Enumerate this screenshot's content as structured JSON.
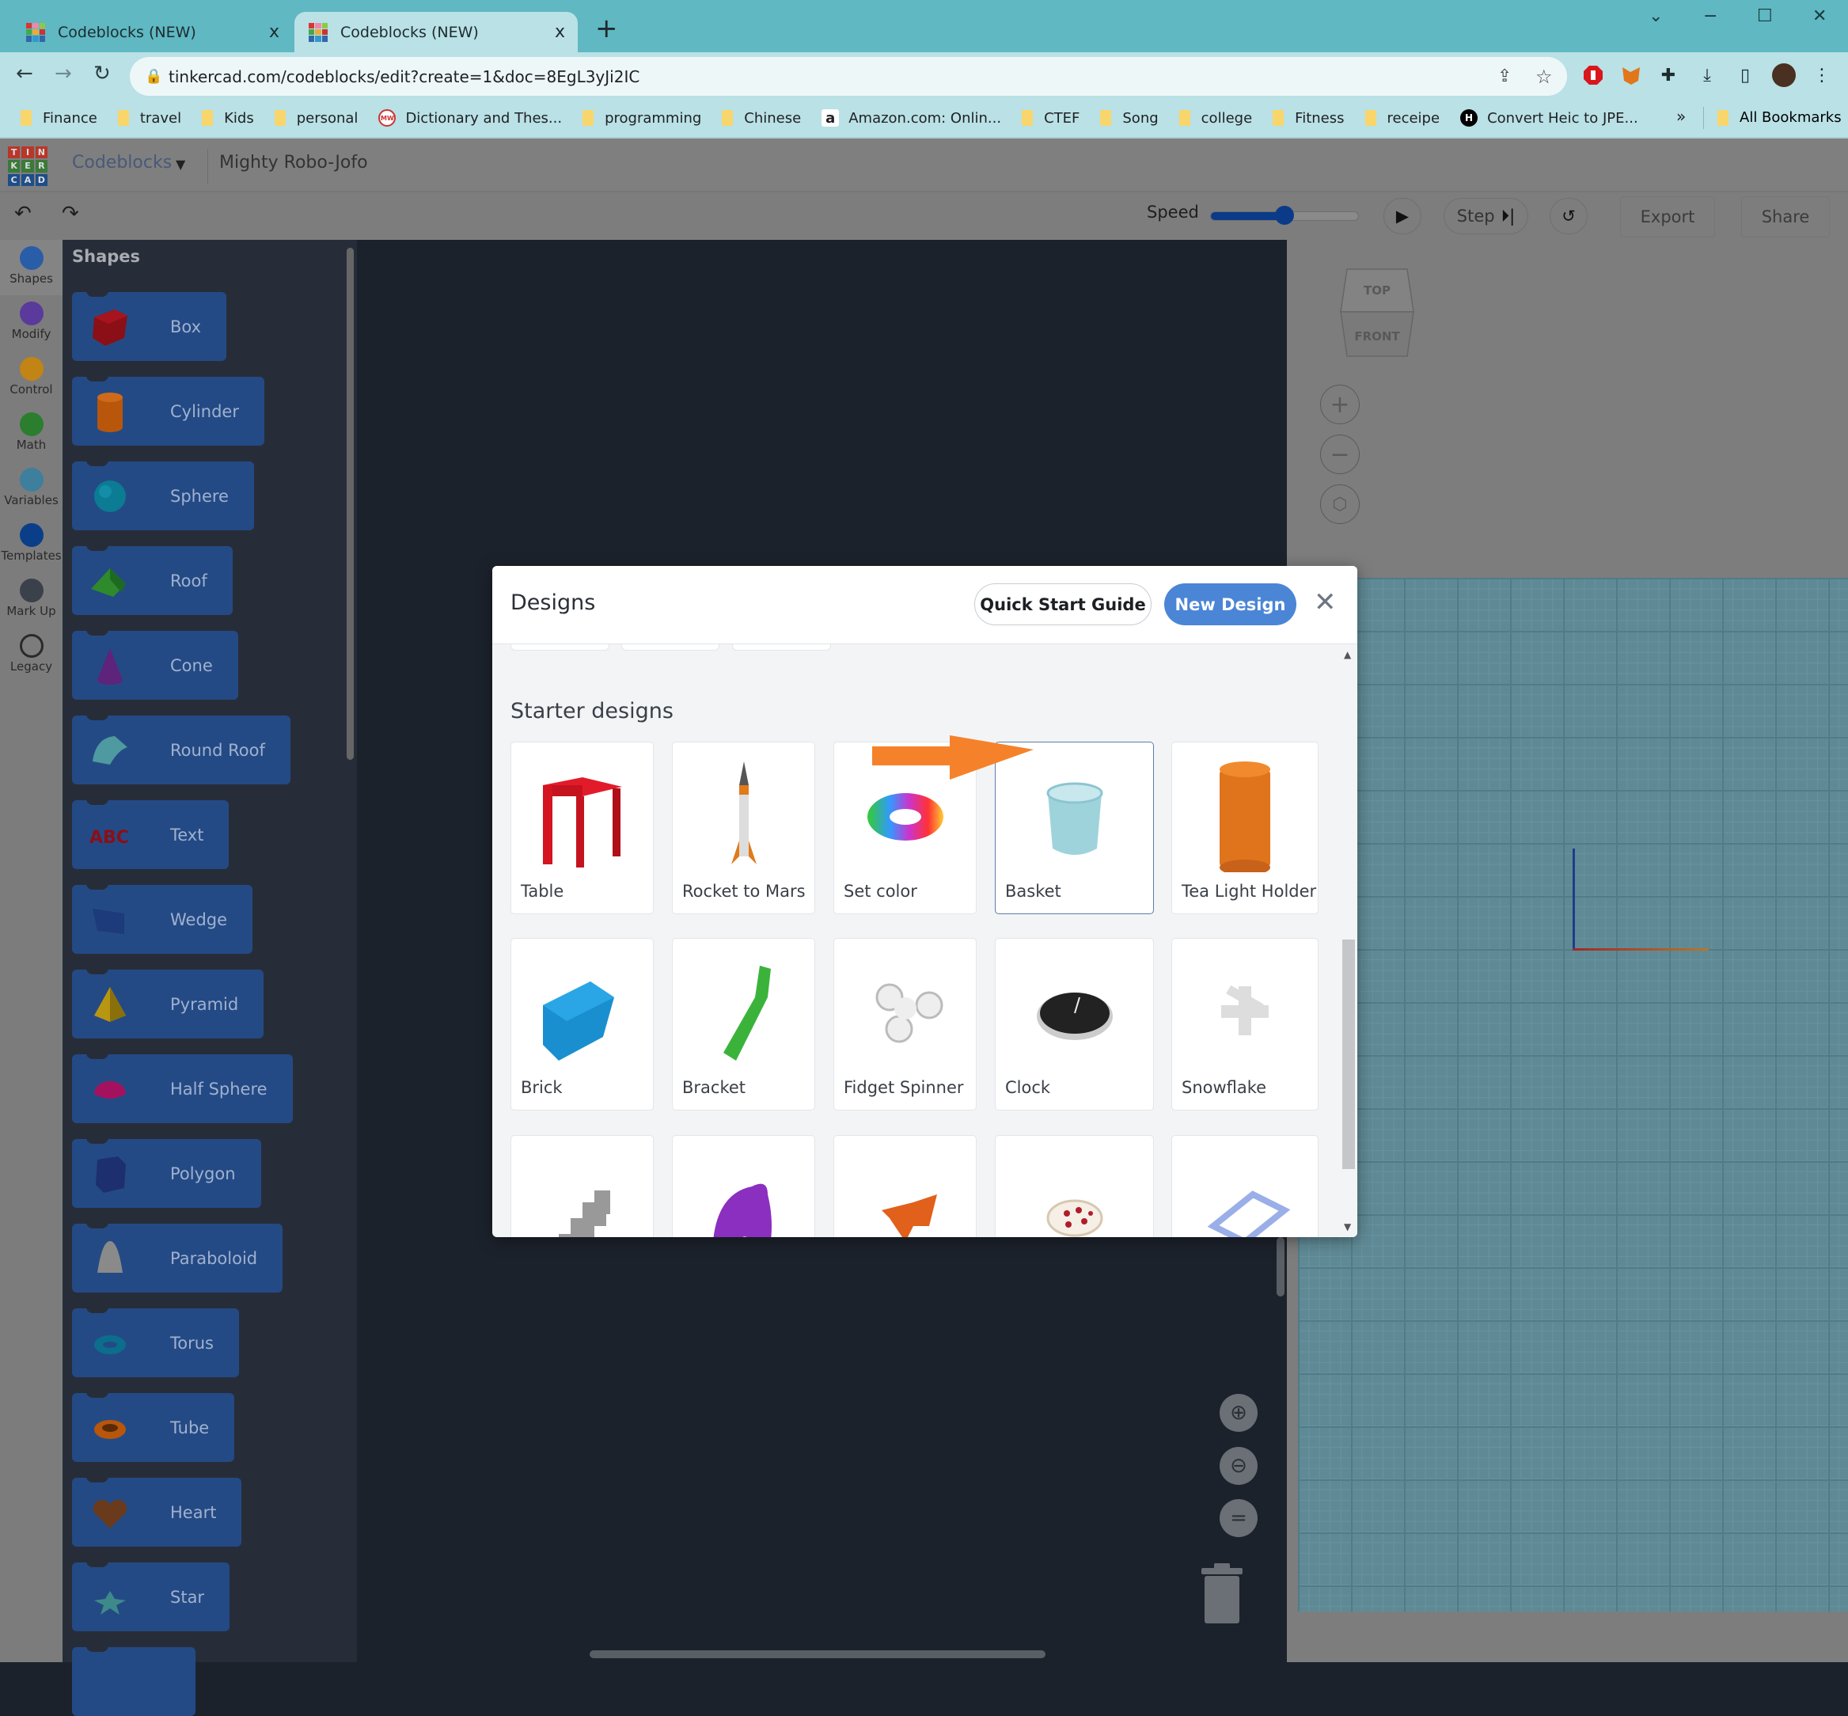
{
  "browser": {
    "tabs": [
      {
        "title": "Codeblocks (NEW)",
        "active": false
      },
      {
        "title": "Codeblocks (NEW)",
        "active": true
      }
    ],
    "close_glyph": "x",
    "new_tab_glyph": "+",
    "url": "tinkercad.com/codeblocks/edit?create=1&doc=8EgL3yJi2IC",
    "bookmarks": [
      {
        "label": "Finance",
        "icon": "folder"
      },
      {
        "label": "travel",
        "icon": "folder"
      },
      {
        "label": "Kids",
        "icon": "folder"
      },
      {
        "label": "personal",
        "icon": "folder"
      },
      {
        "label": "Dictionary and Thes...",
        "icon": "merriam-webster"
      },
      {
        "label": "programming",
        "icon": "folder"
      },
      {
        "label": "Chinese",
        "icon": "folder"
      },
      {
        "label": "Amazon.com: Onlin...",
        "icon": "amazon"
      },
      {
        "label": "CTEF",
        "icon": "folder"
      },
      {
        "label": "Song",
        "icon": "folder"
      },
      {
        "label": "college",
        "icon": "folder"
      },
      {
        "label": "Fitness",
        "icon": "folder"
      },
      {
        "label": "receipe",
        "icon": "folder"
      },
      {
        "label": "Convert Heic to JPE...",
        "icon": "h-logo"
      }
    ],
    "bookmarks_overflow": "»",
    "all_bookmarks": "All Bookmarks"
  },
  "app": {
    "logo_letters": [
      "T",
      "I",
      "N",
      "K",
      "E",
      "R",
      "C",
      "A",
      "D"
    ],
    "product": "Codeblocks",
    "document_name": "Mighty Robo-Jofo",
    "toolbar": {
      "speed_label": "Speed",
      "speed_value_percent": 50,
      "step_label": "Step",
      "export_label": "Export",
      "share_label": "Share"
    },
    "categories": [
      {
        "label": "Shapes",
        "color": "#2a5da8",
        "active": true
      },
      {
        "label": "Modify",
        "color": "#5a3a9a"
      },
      {
        "label": "Control",
        "color": "#c28414"
      },
      {
        "label": "Math",
        "color": "#2a7e2e"
      },
      {
        "label": "Variables",
        "color": "#3d7f9d"
      },
      {
        "label": "Templates",
        "color": "#0b3e88"
      },
      {
        "label": "Mark Up",
        "color": "#3b414a"
      },
      {
        "label": "Legacy",
        "color": "outline"
      }
    ],
    "shapes_title": "Shapes",
    "shapes": [
      {
        "label": "Box",
        "icon": "box",
        "color": "#8b0f16"
      },
      {
        "label": "Cylinder",
        "icon": "cylinder",
        "color": "#b8560c"
      },
      {
        "label": "Sphere",
        "icon": "sphere",
        "color": "#0b7c93"
      },
      {
        "label": "Roof",
        "icon": "roof",
        "color": "#2e8a2c"
      },
      {
        "label": "Cone",
        "icon": "cone",
        "color": "#5e237a"
      },
      {
        "label": "Round Roof",
        "icon": "round-roof",
        "color": "#4e9aa0"
      },
      {
        "label": "Text",
        "icon": "text",
        "color": "#8b0f16"
      },
      {
        "label": "Wedge",
        "icon": "wedge",
        "color": "#1d3a7a"
      },
      {
        "label": "Pyramid",
        "icon": "pyramid",
        "color": "#b89612"
      },
      {
        "label": "Half Sphere",
        "icon": "half-sphere",
        "color": "#a4125f"
      },
      {
        "label": "Polygon",
        "icon": "polygon",
        "color": "#1d2f6e"
      },
      {
        "label": "Paraboloid",
        "icon": "paraboloid",
        "color": "#8a8a8a"
      },
      {
        "label": "Torus",
        "icon": "torus",
        "color": "#0b6e8c"
      },
      {
        "label": "Tube",
        "icon": "tube",
        "color": "#b8560c"
      },
      {
        "label": "Heart",
        "icon": "heart",
        "color": "#6a3a1c"
      },
      {
        "label": "Star",
        "icon": "star",
        "color": "#3e8a8a"
      },
      {
        "label": "",
        "icon": "none",
        "color": "#244a85"
      }
    ],
    "viewcube": {
      "top": "TOP",
      "front": "FRONT"
    }
  },
  "modal": {
    "title": "Designs",
    "quick_start_label": "Quick Start Guide",
    "new_design_label": "New Design",
    "close_glyph": "✕",
    "section_title": "Starter designs",
    "designs": [
      {
        "label": "Table",
        "thumb": "table",
        "selected": false
      },
      {
        "label": "Rocket to Mars",
        "thumb": "rocket",
        "selected": false
      },
      {
        "label": "Set color",
        "thumb": "setcolor",
        "selected": false
      },
      {
        "label": "Basket",
        "thumb": "basket",
        "selected": true
      },
      {
        "label": "Tea Light Holder",
        "thumb": "tealight",
        "selected": false
      },
      {
        "label": "Brick",
        "thumb": "brick",
        "selected": false
      },
      {
        "label": "Bracket",
        "thumb": "bracket",
        "selected": false
      },
      {
        "label": "Fidget Spinner",
        "thumb": "spinner",
        "selected": false
      },
      {
        "label": "Clock",
        "thumb": "clock",
        "selected": false
      },
      {
        "label": "Snowflake",
        "thumb": "snowflake",
        "selected": false
      },
      {
        "label": "",
        "thumb": "stairs",
        "selected": false
      },
      {
        "label": "",
        "thumb": "purple",
        "selected": false
      },
      {
        "label": "",
        "thumb": "pinwheel",
        "selected": false
      },
      {
        "label": "",
        "thumb": "pizza",
        "selected": false
      },
      {
        "label": "",
        "thumb": "frame",
        "selected": false
      }
    ],
    "annotation_arrow_color": "#f5822a"
  },
  "colors": {
    "accent": "#4b85d6",
    "tabbar": "#5fb8c2",
    "chrome": "#b9e1e6"
  }
}
